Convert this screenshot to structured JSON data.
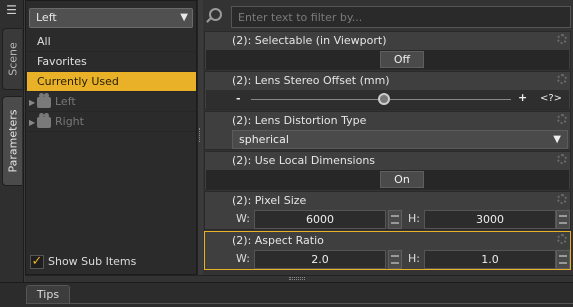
{
  "left_tabs": {
    "scene": "Scene",
    "parameters": "Parameters"
  },
  "camera_dropdown": {
    "value": "Left"
  },
  "list_items": [
    "All",
    "Favorites",
    "Currently Used"
  ],
  "cameras": [
    {
      "label": "Left"
    },
    {
      "label": "Right"
    }
  ],
  "show_sub_items": {
    "label": "Show Sub Items",
    "checked": true
  },
  "filter": {
    "placeholder": "Enter text to filter by..."
  },
  "properties": {
    "selectable": {
      "title": "(2): Selectable (in Viewport)",
      "value": "Off"
    },
    "lens_stereo_offset": {
      "title": "(2): Lens Stereo Offset (mm)",
      "minus": "-",
      "plus": "+",
      "value_label": "<?>",
      "slider_position": 0.5
    },
    "lens_distortion_type": {
      "title": "(2): Lens Distortion Type",
      "value": "spherical"
    },
    "use_local_dimensions": {
      "title": "(2): Use Local Dimensions",
      "value": "On"
    },
    "pixel_size": {
      "title": "(2): Pixel Size",
      "w_label": "W:",
      "w_value": "6000",
      "h_label": "H:",
      "h_value": "3000"
    },
    "aspect_ratio": {
      "title": "(2): Aspect Ratio",
      "w_label": "W:",
      "w_value": "2.0",
      "h_label": "H:",
      "h_value": "1.0"
    }
  },
  "bottom": {
    "tips_tab": "Tips"
  },
  "colors": {
    "highlight": "#e8b128",
    "panel": "#3f3f3f"
  }
}
